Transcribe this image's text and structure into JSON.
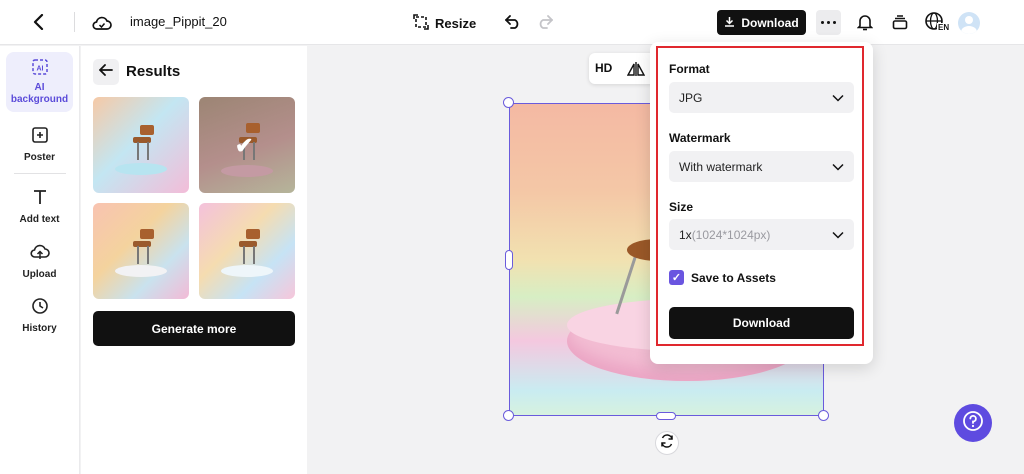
{
  "header": {
    "file_name": "image_Pippit_20",
    "resize_label": "Resize",
    "download_label": "Download",
    "language_badge": "EN"
  },
  "sidebar": {
    "items": [
      {
        "label": "AI\nbackground",
        "icon": "ai-background-icon",
        "active": true
      },
      {
        "label": "Poster",
        "icon": "poster-icon"
      },
      {
        "label": "Add text",
        "icon": "text-icon"
      },
      {
        "label": "Upload",
        "icon": "upload-icon"
      },
      {
        "label": "History",
        "icon": "history-icon"
      }
    ]
  },
  "results": {
    "title": "Results",
    "generate_more_label": "Generate more",
    "selected_index": 1
  },
  "canvas": {
    "hd_label": "HD"
  },
  "download_panel": {
    "format_label": "Format",
    "format_value": "JPG",
    "watermark_label": "Watermark",
    "watermark_value": "With watermark",
    "size_label": "Size",
    "size_value": "1x",
    "size_hint": "(1024*1024px)",
    "save_to_assets_label": "Save to Assets",
    "save_to_assets_checked": true,
    "download_button_label": "Download"
  },
  "colors": {
    "accent": "#6a5bdc",
    "highlight": "#e0282e",
    "primary_button": "#111111"
  }
}
